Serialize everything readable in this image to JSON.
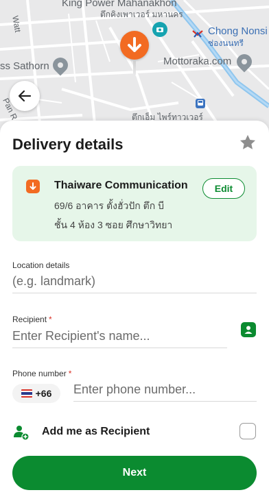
{
  "map": {
    "labels": {
      "king_power": "King Power Mahanakhon",
      "king_power_th": "ตึกคิงเพาเวอร์ มหานคร",
      "chong_nonsi": "Chong Nonsi",
      "chong_nonsi_th": "ช่องนนทรี",
      "sathorn": "ss Sathorn",
      "mottoraka": "Mottoraka.com",
      "tower_th": "ตึกเอ็ม ไพร์ทาวเวอร์",
      "wattha": "Watt",
      "pan_road": "Pan R"
    },
    "colors": {
      "road": "#ffffff",
      "transit": "#8fc6ee",
      "pin": "#f26b22"
    }
  },
  "back_icon": "arrow-left-icon",
  "sheet": {
    "title": "Delivery details",
    "favorite_icon": "star-icon"
  },
  "address": {
    "name": "Thaiware Communication",
    "line1": "69/6 อาคาร ตั้งฮั่วปัก ตึก บี",
    "line2": "ชั้น 4 ห้อง 3 ซอย ศึกษาวิทยา",
    "edit_label": "Edit"
  },
  "location": {
    "label": "Location details",
    "placeholder": "(e.g. landmark)"
  },
  "recipient": {
    "label": "Recipient",
    "required_mark": "*",
    "placeholder": "Enter Recipient's name..."
  },
  "phone": {
    "label": "Phone number",
    "required_mark": "*",
    "country_code": "+66",
    "placeholder": "Enter phone number..."
  },
  "add_me": {
    "label": "Add me as Recipient",
    "checked": false
  },
  "next_label": "Next",
  "colors": {
    "primary_green": "#0b8b30",
    "card_green": "#e6f6e9",
    "orange": "#f26b22",
    "required": "#d93025"
  }
}
